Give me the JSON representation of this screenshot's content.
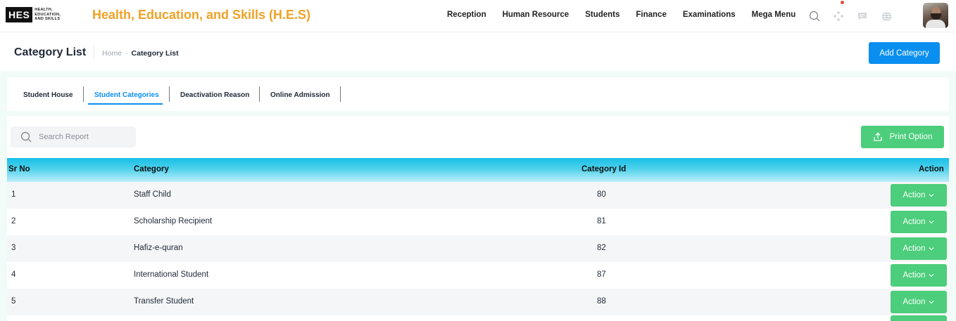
{
  "brand": {
    "logo_mark": "HES",
    "logo_words": [
      "HEALTH,",
      "EDUCATION,",
      "AND SKILLS"
    ],
    "app_title": "Health, Education, and Skills (H.E.S)",
    "accent_color": "#f0a227"
  },
  "nav": [
    "Reception",
    "Human Resource",
    "Students",
    "Finance",
    "Examinations",
    "Mega Menu"
  ],
  "header_icons": [
    "search-icon",
    "apps-grid-icon",
    "message-icon",
    "globe-icon"
  ],
  "page": {
    "title": "Category List",
    "breadcrumb_home": "Home",
    "breadcrumb_separator": "-",
    "breadcrumb_current": "Category List",
    "add_button": "Add Category"
  },
  "tabs": [
    {
      "label": "Student House",
      "active": false
    },
    {
      "label": "Student Categories",
      "active": true
    },
    {
      "label": "Deactivation Reason",
      "active": false
    },
    {
      "label": "Online Admission",
      "active": false
    }
  ],
  "toolbar": {
    "search_placeholder": "Search Report",
    "print_label": "Print Option"
  },
  "table": {
    "columns": [
      "Sr No",
      "Category",
      "Category Id",
      "Action"
    ],
    "rows": [
      {
        "sr": "1",
        "category": "Staff Child",
        "id": "80",
        "action": "Action"
      },
      {
        "sr": "2",
        "category": "Scholarship Recipient",
        "id": "81",
        "action": "Action"
      },
      {
        "sr": "3",
        "category": "Hafiz-e-quran",
        "id": "82",
        "action": "Action"
      },
      {
        "sr": "4",
        "category": "International Student",
        "id": "87",
        "action": "Action"
      },
      {
        "sr": "5",
        "category": "Transfer Student",
        "id": "88",
        "action": "Action"
      }
    ]
  },
  "colors": {
    "primary": "#0a8ff0",
    "success": "#4cce7c",
    "header_gradient_top": "#17c0e6"
  }
}
